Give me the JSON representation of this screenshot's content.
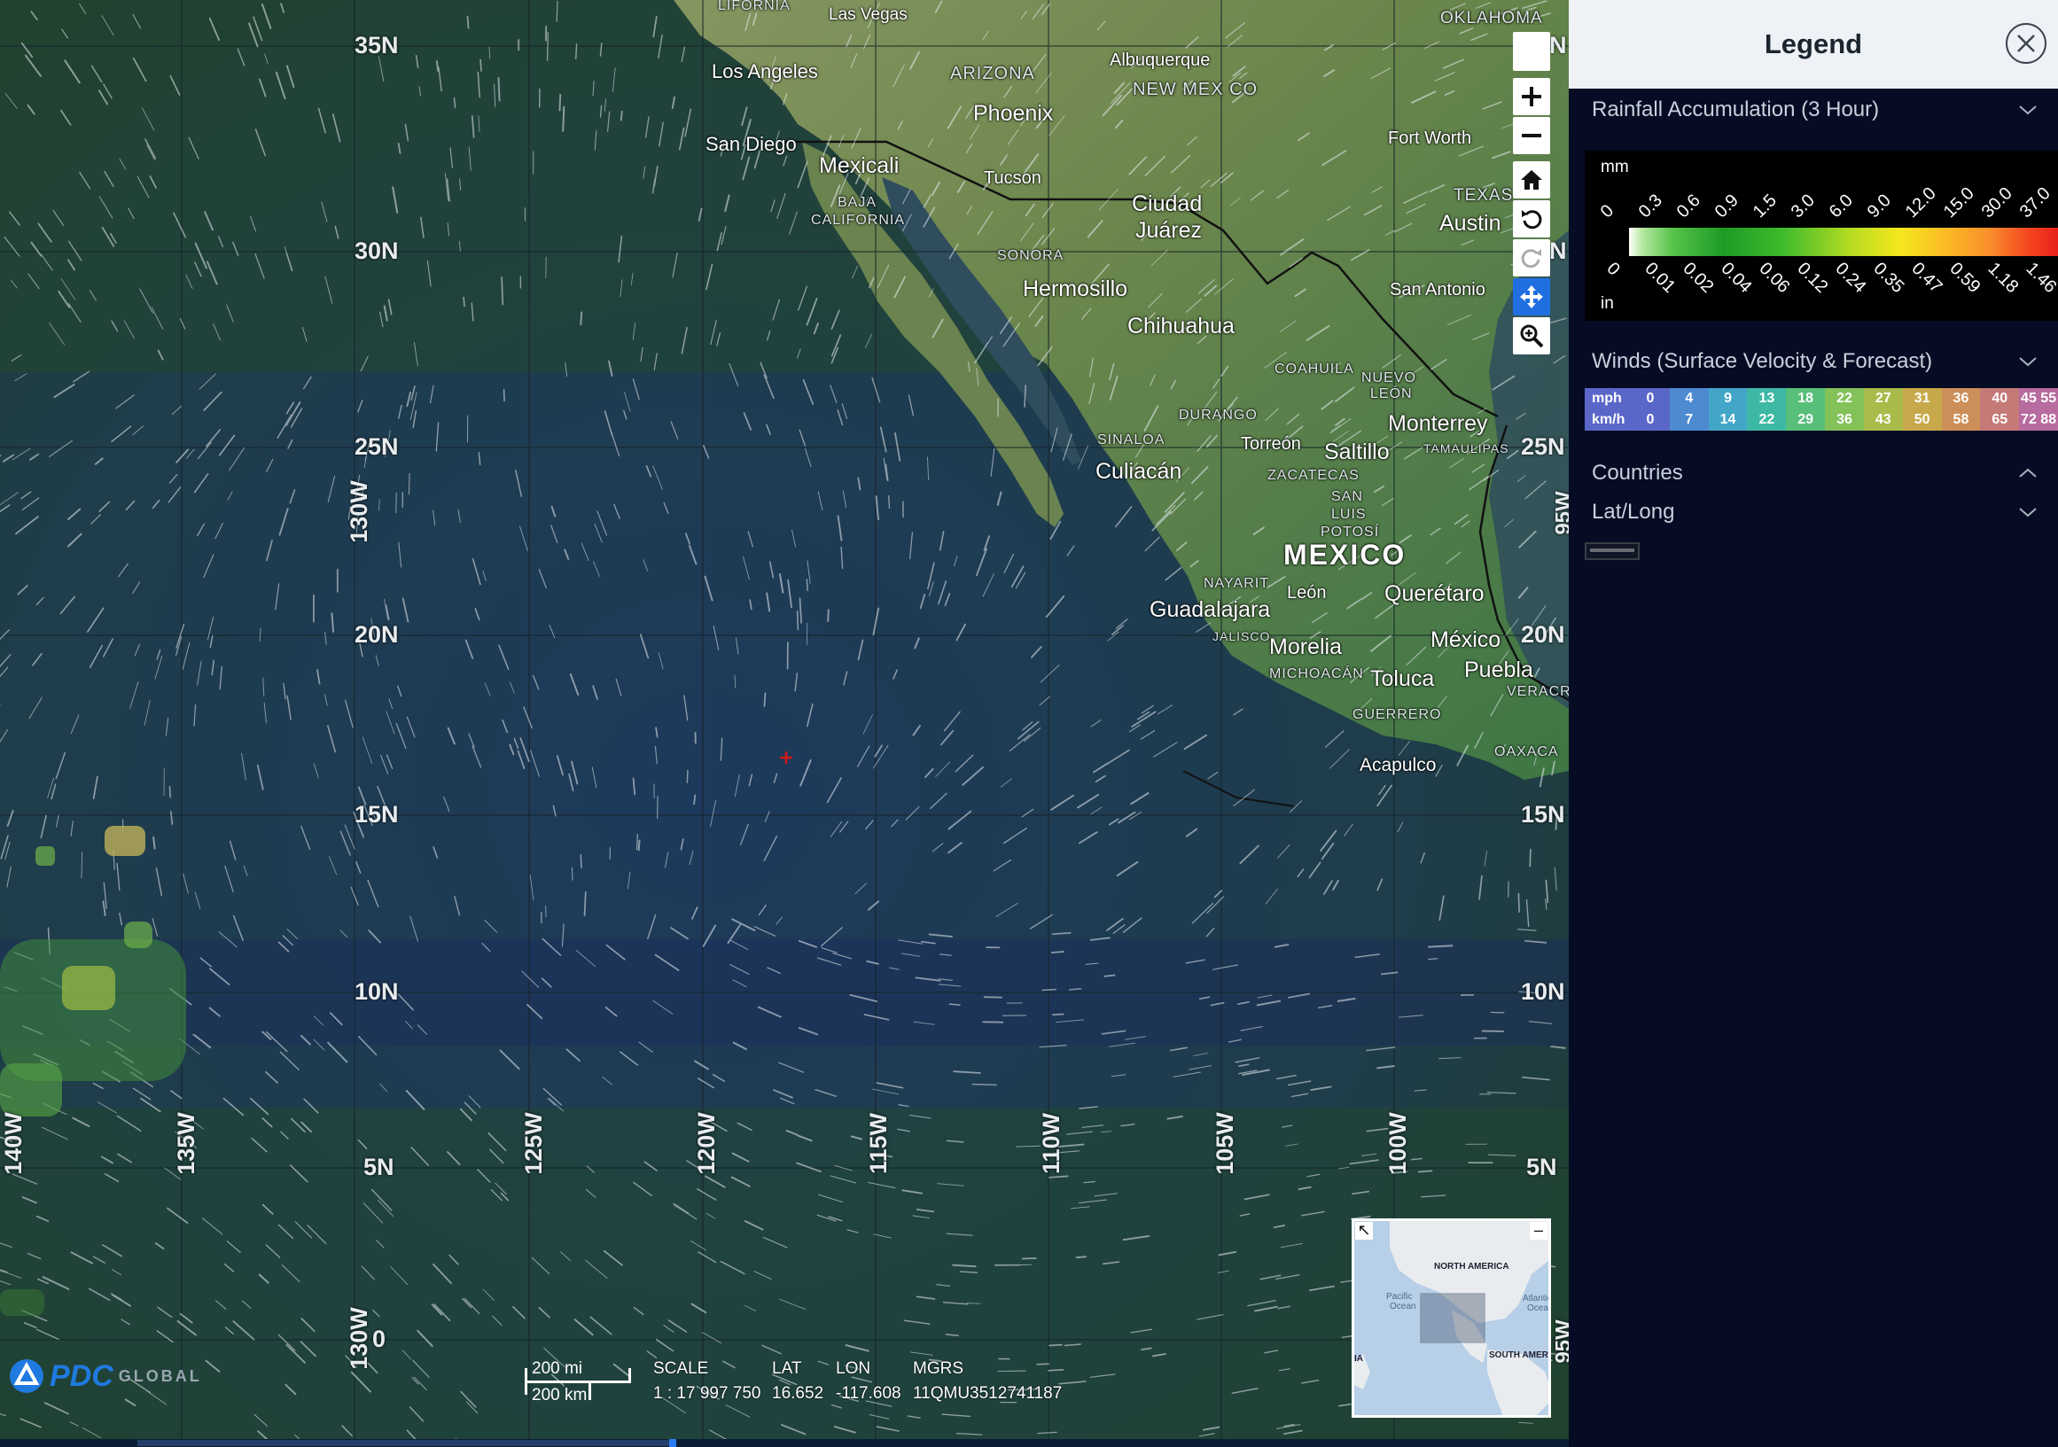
{
  "legend": {
    "title": "Legend",
    "sections": {
      "rainfall": {
        "title": "Rainfall Accumulation (3 Hour)",
        "unit_top": "mm",
        "unit_bottom": "in",
        "mm_ticks": [
          "0",
          "0.3",
          "0.6",
          "0.9",
          "1.5",
          "3.0",
          "6.0",
          "9.0",
          "12.0",
          "15.0",
          "30.0",
          "37.0"
        ],
        "in_ticks": [
          "0",
          "0.01",
          "0.02",
          "0.04",
          "0.06",
          "0.12",
          "0.24",
          "0.35",
          "0.47",
          "0.59",
          "1.18",
          "1.46"
        ]
      },
      "winds": {
        "title": "Winds (Surface Velocity & Forecast)",
        "mph_label": "mph",
        "kmh_label": "km/h",
        "mph": [
          "0",
          "4",
          "9",
          "13",
          "18",
          "22",
          "27",
          "31",
          "36",
          "40",
          "45",
          "55"
        ],
        "kmh": [
          "0",
          "7",
          "14",
          "22",
          "29",
          "36",
          "43",
          "50",
          "58",
          "65",
          "72",
          "88"
        ],
        "colors": [
          "#5a67c8",
          "#4d8ad0",
          "#43a6c8",
          "#3db8a5",
          "#57bf79",
          "#83c259",
          "#a9bb4a",
          "#c7a94b",
          "#cc8f59",
          "#c57a78",
          "#b76b9e",
          "#a565c7"
        ]
      },
      "countries": {
        "title": "Countries"
      },
      "latlong": {
        "title": "Lat/Long"
      }
    }
  },
  "map": {
    "lat_labels": [
      "35N",
      "30N",
      "25N",
      "20N",
      "15N",
      "10N",
      "5N",
      "0"
    ],
    "lat_labels_right": [
      "N",
      "N",
      "25N",
      "20N",
      "15N",
      "10N",
      "5N"
    ],
    "lon_labels": [
      "140W",
      "135W",
      "125W",
      "120W",
      "115W",
      "110W",
      "105W",
      "100W"
    ],
    "lon_labels_top_left": [
      "130W",
      "130W"
    ],
    "right_edge_labels": [
      "95W",
      "95W"
    ],
    "cities": {
      "las_vegas": "Las Vegas",
      "california": "LIFORNIA",
      "oklahoma": "OKLAHOMA",
      "los_angeles": "Los Angeles",
      "arizona": "ARIZONA",
      "albuquerque": "Albuquerque",
      "new_mexico": "NEW MEX CO",
      "phoenix": "Phoenix",
      "fort_worth": "Fort Worth",
      "san_diego": "San Diego",
      "mexicali": "Mexicali",
      "tucson": "Tucson",
      "baja": "BAJA",
      "california_2": "CALIFORNIA",
      "ciudad_juarez_1": "Ciudad",
      "ciudad_juarez_2": "Juárez",
      "texas": "TEXAS",
      "austin": "Austin",
      "sonora": "SONORA",
      "hermosillo": "Hermosillo",
      "chihuahua": "Chihuahua",
      "san_antonio": "San Antonio",
      "coahuila": "COAHUILA",
      "nuevo_leon_1": "NUEVO",
      "nuevo_leon_2": "LEÓN",
      "durango": "DURANGO",
      "monterrey": "Monterrey",
      "sinaloa": "SINALOA",
      "torreon": "Torreón",
      "saltillo": "Saltillo",
      "tamaulipas": "TAMAULIPAS",
      "culiacan": "Culiacán",
      "zacatecas": "ZACATECAS",
      "san_luis_1": "SAN",
      "san_luis_2": "LUIS",
      "san_luis_3": "POTOSÍ",
      "mexico": "MEXICO",
      "nayarit": "NAYARIT",
      "leon": "León",
      "queretaro": "Querétaro",
      "guadalajara": "Guadalajara",
      "jalisco": "JALISCO",
      "morelia": "Morelia",
      "mexico_city": "México",
      "michoacan": "MICHOACÁN",
      "toluca": "Toluca",
      "puebla": "Puebla",
      "veracruz": "VERACRU",
      "guerrero": "GUERRERO",
      "oaxaca": "OAXACA",
      "acapulco": "Acapulco"
    },
    "scale": {
      "mi": "200 mi",
      "km": "200 km",
      "scale_label": "SCALE",
      "lat_label": "LAT",
      "lon_label": "LON",
      "mgrs_label": "MGRS",
      "scale_value": "1 : 17 997 750",
      "lat_value": "16.652",
      "lon_value": "-117.608",
      "mgrs_value": "11QMU3512741187"
    },
    "logo": {
      "brand": "PDC",
      "suffix": "GLOBAL"
    },
    "minimap": {
      "north_america": "NORTH AMERICA",
      "pacific_1": "Pacific",
      "pacific_2": "Ocean",
      "atlantic_1": "Atlantic",
      "atlantic_2": "Ocea",
      "south_america": "SOUTH AMERI",
      "asia": "IA",
      "collapse_symbol": "–",
      "expand_symbol": "↖"
    }
  }
}
